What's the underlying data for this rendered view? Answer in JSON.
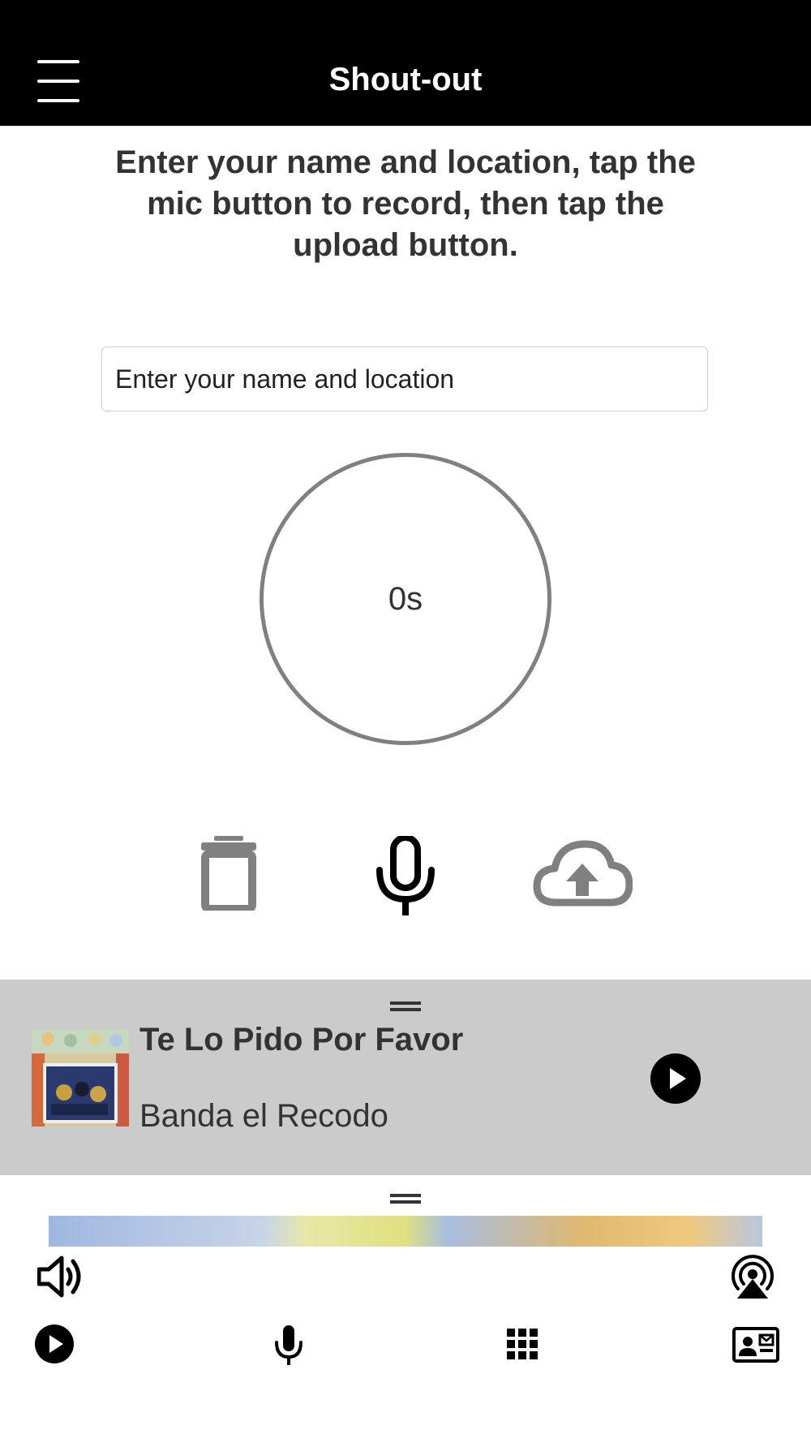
{
  "header": {
    "title": "Shout-out",
    "menu_icon": "hamburger-menu-icon"
  },
  "instructions": "Enter your name and location, tap the mic button to record, then tap the upload button.",
  "name_input": {
    "placeholder": "Enter your name and location",
    "value": ""
  },
  "timer": {
    "text": "0s"
  },
  "actions": {
    "delete_icon": "trash-icon",
    "record_icon": "microphone-icon",
    "upload_icon": "cloud-upload-icon"
  },
  "now_playing": {
    "title": "Te Lo Pido Por Favor",
    "artist": "Banda el Recodo",
    "play_icon": "play-icon"
  },
  "bottom_bar": {
    "volume_icon": "volume-icon",
    "airplay_icon": "airplay-icon",
    "play_icon": "play-icon",
    "mic_icon": "microphone-icon",
    "grid_icon": "grid-icon",
    "contact_icon": "contact-card-icon"
  },
  "colors": {
    "header_bg": "#000000",
    "player_bg": "#cbcbcb",
    "ring": "#808080",
    "text": "#333333"
  }
}
